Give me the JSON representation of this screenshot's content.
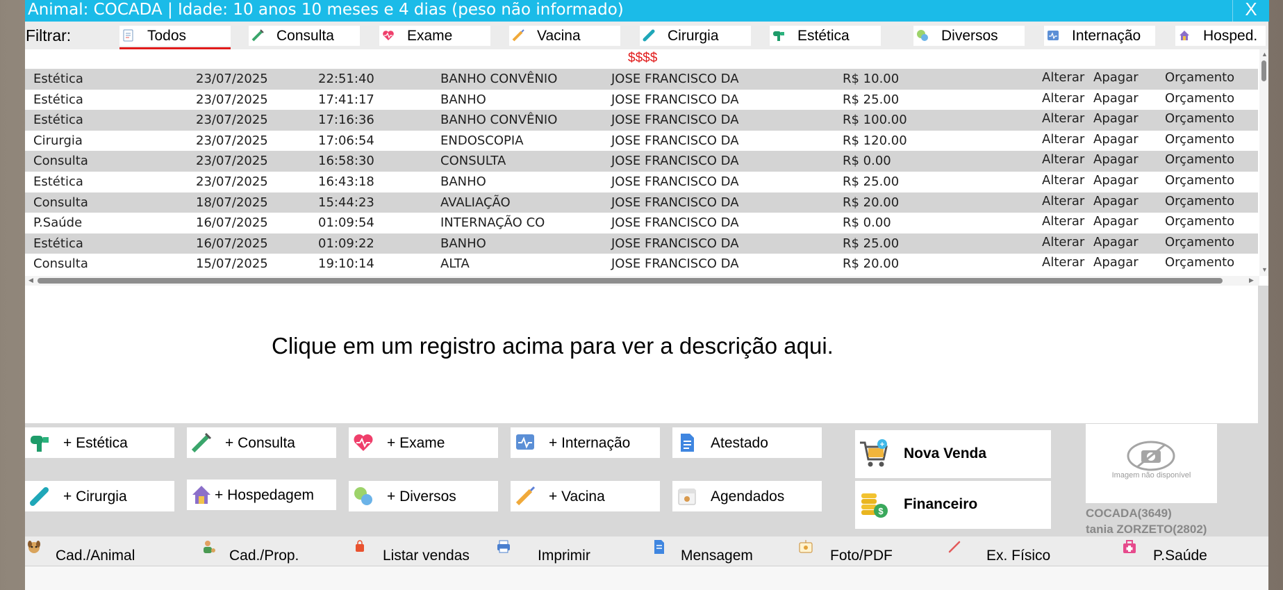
{
  "window": {
    "title": "Animal: COCADA | Idade: 10 anos 10 meses e 4 dias (peso não informado)",
    "close_label": "X"
  },
  "filter": {
    "label": "Filtrar:",
    "tabs": [
      {
        "label": "Todos",
        "icon": "notepad-icon",
        "active": true
      },
      {
        "label": "Consulta",
        "icon": "syringe-icon"
      },
      {
        "label": "Exame",
        "icon": "heart-pulse-icon"
      },
      {
        "label": "Vacina",
        "icon": "vaccine-icon"
      },
      {
        "label": "Cirurgia",
        "icon": "test-tube-icon"
      },
      {
        "label": "Estética",
        "icon": "hair-dryer-icon"
      },
      {
        "label": "Diversos",
        "icon": "chat-bubbles-icon"
      },
      {
        "label": "Internação",
        "icon": "monitor-icon"
      },
      {
        "label": "Hosped.",
        "icon": "house-icon"
      }
    ]
  },
  "grid": {
    "value_header": "$$$$",
    "rows": [
      {
        "type": "Estética",
        "date": "23/07/2025",
        "time": "22:51:40",
        "service": "BANHO CONVÊNIO",
        "person": "JOSE FRANCISCO DA",
        "value": "R$ 10.00",
        "edit": "Alterar",
        "delete": "Apagar",
        "quote": "Orçamento"
      },
      {
        "type": "Estética",
        "date": "23/07/2025",
        "time": "17:41:17",
        "service": "BANHO",
        "person": "JOSE FRANCISCO DA",
        "value": "R$ 25.00",
        "edit": "Alterar",
        "delete": "Apagar",
        "quote": "Orçamento"
      },
      {
        "type": "Estética",
        "date": "23/07/2025",
        "time": "17:16:36",
        "service": "BANHO CONVÊNIO",
        "person": "JOSE FRANCISCO DA",
        "value": "R$ 100.00",
        "edit": "Alterar",
        "delete": "Apagar",
        "quote": "Orçamento"
      },
      {
        "type": "Cirurgia",
        "date": "23/07/2025",
        "time": "17:06:54",
        "service": "ENDOSCOPIA",
        "person": "JOSE FRANCISCO DA",
        "value": "R$ 120.00",
        "edit": "Alterar",
        "delete": "Apagar",
        "quote": "Orçamento"
      },
      {
        "type": "Consulta",
        "date": "23/07/2025",
        "time": "16:58:30",
        "service": "CONSULTA",
        "person": "JOSE FRANCISCO DA",
        "value": "R$ 0.00",
        "edit": "Alterar",
        "delete": "Apagar",
        "quote": "Orçamento"
      },
      {
        "type": "Estética",
        "date": "23/07/2025",
        "time": "16:43:18",
        "service": "BANHO",
        "person": "JOSE FRANCISCO DA",
        "value": "R$ 25.00",
        "edit": "Alterar",
        "delete": "Apagar",
        "quote": "Orçamento"
      },
      {
        "type": "Consulta",
        "date": "18/07/2025",
        "time": "15:44:23",
        "service": "AVALIAÇÃO",
        "person": "JOSE FRANCISCO DA",
        "value": "R$ 20.00",
        "edit": "Alterar",
        "delete": "Apagar",
        "quote": "Orçamento"
      },
      {
        "type": "P.Saúde",
        "date": "16/07/2025",
        "time": "01:09:54",
        "service": "INTERNAÇÃO CO",
        "person": "JOSE FRANCISCO DA",
        "value": "R$ 0.00",
        "edit": "Alterar",
        "delete": "Apagar",
        "quote": "Orçamento"
      },
      {
        "type": "Estética",
        "date": "16/07/2025",
        "time": "01:09:22",
        "service": "BANHO",
        "person": "JOSE FRANCISCO DA",
        "value": "R$ 25.00",
        "edit": "Alterar",
        "delete": "Apagar",
        "quote": "Orçamento"
      },
      {
        "type": "Consulta",
        "date": "15/07/2025",
        "time": "19:10:14",
        "service": "ALTA",
        "person": "JOSE FRANCISCO DA",
        "value": "R$ 20.00",
        "edit": "Alterar",
        "delete": "Apagar",
        "quote": "Orçamento"
      }
    ]
  },
  "description": {
    "placeholder": "Clique em um registro acima para ver a descrição aqui."
  },
  "actions": {
    "estetica": "+ Estética",
    "consulta": "+ Consulta",
    "exame": "+ Exame",
    "internacao": "+ Internação",
    "atestado": "Atestado",
    "cirurgia": "+ Cirurgia",
    "hospedagem": "+ Hospedagem",
    "diversos": "+ Diversos",
    "vacina": "+ Vacina",
    "agendados": "Agendados",
    "nova_venda": "Nova Venda",
    "financeiro": "Financeiro"
  },
  "photo": {
    "caption": "Imagem não disponível"
  },
  "animal": {
    "id_label": "COCADA(3649)",
    "owner_label": "tania ZORZETO(2802)"
  },
  "bottom": {
    "cad_animal": "Cad./Animal",
    "cad_prop": "Cad./Prop.",
    "listar_vendas": "Listar vendas",
    "imprimir": "Imprimir",
    "mensagem": "Mensagem",
    "foto_pdf": "Foto/PDF",
    "ex_fisico": "Ex. Físico",
    "p_saude": "P.Saúde"
  },
  "colors": {
    "titlebar": "#1bbbe8",
    "active_underline": "#e11b1b",
    "value_header": "#e11b1b"
  }
}
